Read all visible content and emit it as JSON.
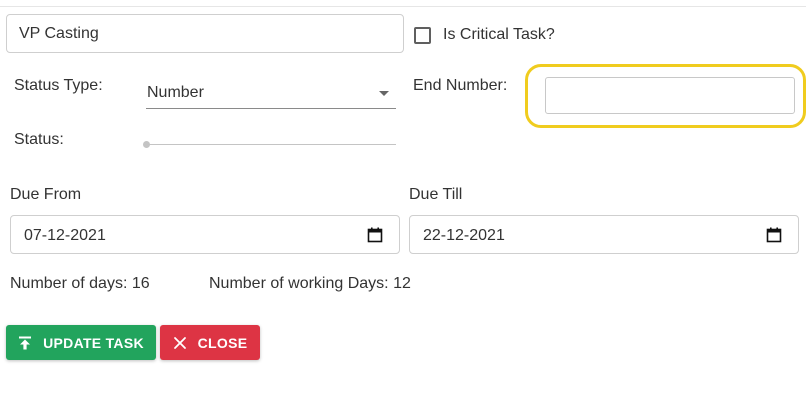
{
  "task": {
    "name_value": "VP Casting",
    "critical_label": "Is Critical Task?",
    "critical_checked": false
  },
  "status_type": {
    "label": "Status Type:",
    "selected": "Number"
  },
  "end_number": {
    "label": "End Number:",
    "value": "",
    "highlight_color": "#f0cc1e"
  },
  "status": {
    "label": "Status:",
    "level": 0
  },
  "due_from": {
    "label": "Due From",
    "value": "07-12-2021"
  },
  "due_till": {
    "label": "Due Till",
    "value": "22-12-2021"
  },
  "summary": {
    "days_text": "Number of days: 16",
    "working_days_text": "Number of working Days: 12"
  },
  "actions": {
    "update_label": "UPDATE TASK",
    "update_color": "#22a45d",
    "update_icon": "upload-icon",
    "close_label": "CLOSE",
    "close_color": "#dd3444",
    "close_icon": "close-icon"
  }
}
